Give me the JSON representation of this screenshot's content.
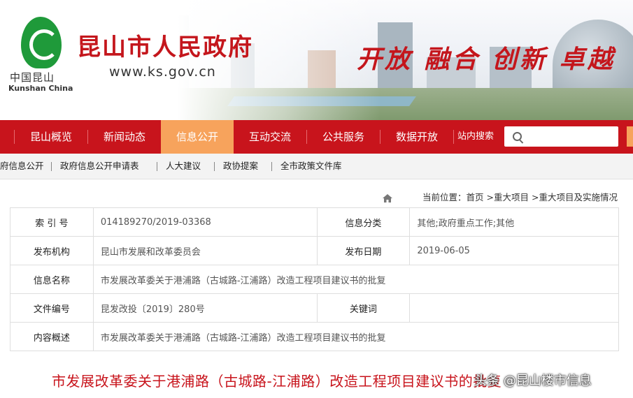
{
  "banner": {
    "logo_cn": "中国昆山",
    "logo_en": "Kunshan China",
    "title": "昆山市人民政府",
    "url": "www.ks.gov.cn",
    "slogan": "开放 融合 创新 卓越"
  },
  "nav": {
    "items": [
      {
        "label": "昆山概览"
      },
      {
        "label": "新闻动态"
      },
      {
        "label": "信息公开",
        "active": true
      },
      {
        "label": "互动交流"
      },
      {
        "label": "公共服务"
      },
      {
        "label": "数据开放"
      }
    ],
    "search_label": "站内搜索",
    "search_value": ""
  },
  "subnav": {
    "items": [
      "府信息公开",
      "政府信息公开申请表",
      "人大建议",
      "政协提案",
      "全市政策文件库"
    ]
  },
  "breadcrumb": {
    "prefix": "当前位置：",
    "items": [
      "首页",
      ">重大项目",
      ">重大项目及实施情况"
    ]
  },
  "info_table": {
    "rows": [
      {
        "label": "索 引 号",
        "value": "014189270/2019-03368",
        "label2": "信息分类",
        "value2": "其他;政府重点工作;其他"
      },
      {
        "label": "发布机构",
        "value": "昆山市发展和改革委员会",
        "label2": "发布日期",
        "value2": "2019-06-05"
      },
      {
        "label": "信息名称",
        "value": "市发展改革委关于港浦路（古城路-江浦路）改造工程项目建议书的批复"
      },
      {
        "label": "文件编号",
        "value": "昆发改投〔2019〕280号",
        "label2": "关键词",
        "value2": ""
      },
      {
        "label": "内容概述",
        "value": "市发展改革委关于港浦路（古城路-江浦路）改造工程项目建议书的批复"
      }
    ]
  },
  "article": {
    "title": "市发展改革委关于港浦路（古城路-江浦路）改造工程项目建议书的批复"
  },
  "watermark": "头条 @昆山楼市信息",
  "colors": {
    "primary_red": "#c8141c",
    "nav_active": "#f7a35c",
    "logo_green": "#1f9a3a"
  }
}
